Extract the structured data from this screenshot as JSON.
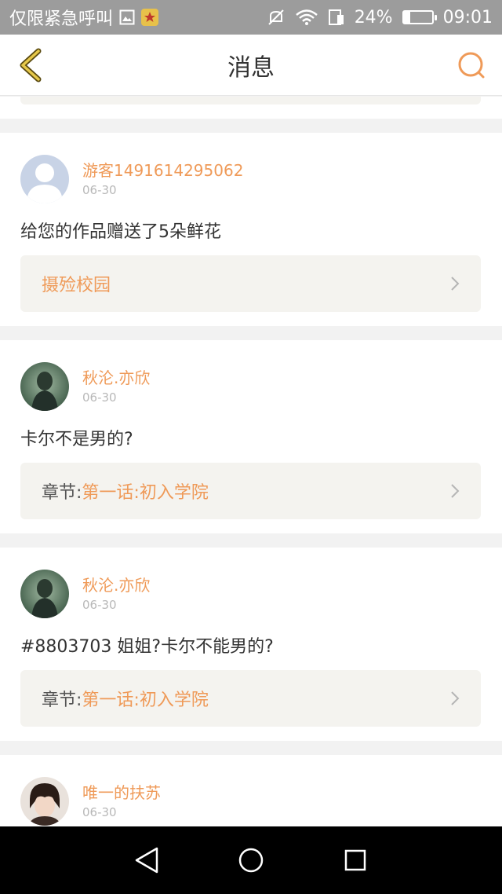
{
  "status_bar": {
    "carrier_text": "仅限紧急呼叫",
    "battery_percent": "24%",
    "battery_level": 0.24,
    "time": "09:01",
    "icons": [
      "image-icon",
      "app-badge-icon",
      "mute-icon",
      "wifi-icon",
      "sim-icon",
      "battery-icon"
    ]
  },
  "header": {
    "title": "消息",
    "back_icon": "chevron-left-icon",
    "search_icon": "search-icon",
    "accent_color": "#ef9a58"
  },
  "messages": [
    {
      "username": "游客1491614295062",
      "date": "06-30",
      "text": "给您的作品赠送了5朵鲜花",
      "link_label": "",
      "link_title": "摄殓校园"
    },
    {
      "username": "秋沦.亦欣",
      "date": "06-30",
      "text": "卡尔不是男的?",
      "link_label": "章节:",
      "link_title": "第一话:初入学院"
    },
    {
      "username": "秋沦.亦欣",
      "date": "06-30",
      "text": "#8803703 姐姐?卡尔不能男的?",
      "link_label": "章节:",
      "link_title": "第一话:初入学院"
    },
    {
      "username": "唯一的扶苏",
      "date": "06-30",
      "text": "",
      "link_label": "",
      "link_title": ""
    }
  ],
  "nav_bar": {
    "back": "triangle-back-icon",
    "home": "circle-home-icon",
    "recents": "square-recents-icon"
  }
}
